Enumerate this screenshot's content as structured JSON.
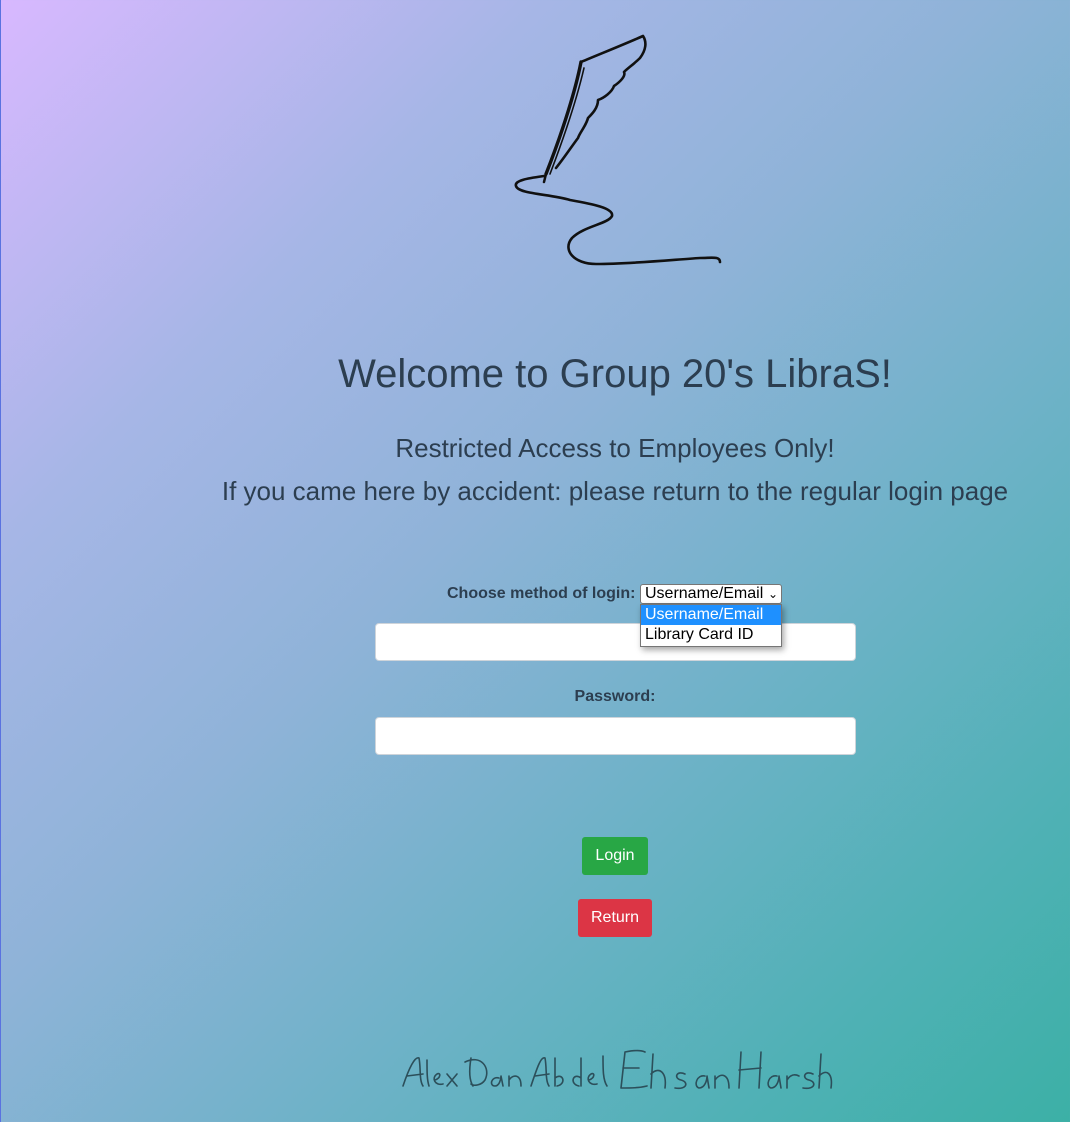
{
  "header": {
    "title": "Welcome to Group 20's LibraS!",
    "subtitle_line1": "Restricted Access to Employees Only!",
    "subtitle_line2": "If you came here by accident: please return to the regular login page"
  },
  "logo": {
    "icon": "quill-signature-icon"
  },
  "login_form": {
    "method_label": "Choose method of login:",
    "method_select_value": "Username/Email",
    "method_options": [
      "Username/Email",
      "Library Card ID"
    ],
    "method_options_selected_index": 0,
    "username_value": "",
    "password_label": "Password:",
    "password_value": "",
    "login_button": "Login",
    "return_button": "Return"
  },
  "footer": {
    "signatures": [
      "Alex",
      "Dan",
      "Abdel",
      "Ehsan",
      "Harsh"
    ]
  },
  "colors": {
    "login_button": "#28a745",
    "return_button": "#dc3545",
    "text": "#2c3e50",
    "dropdown_highlight": "#1e90ff"
  }
}
